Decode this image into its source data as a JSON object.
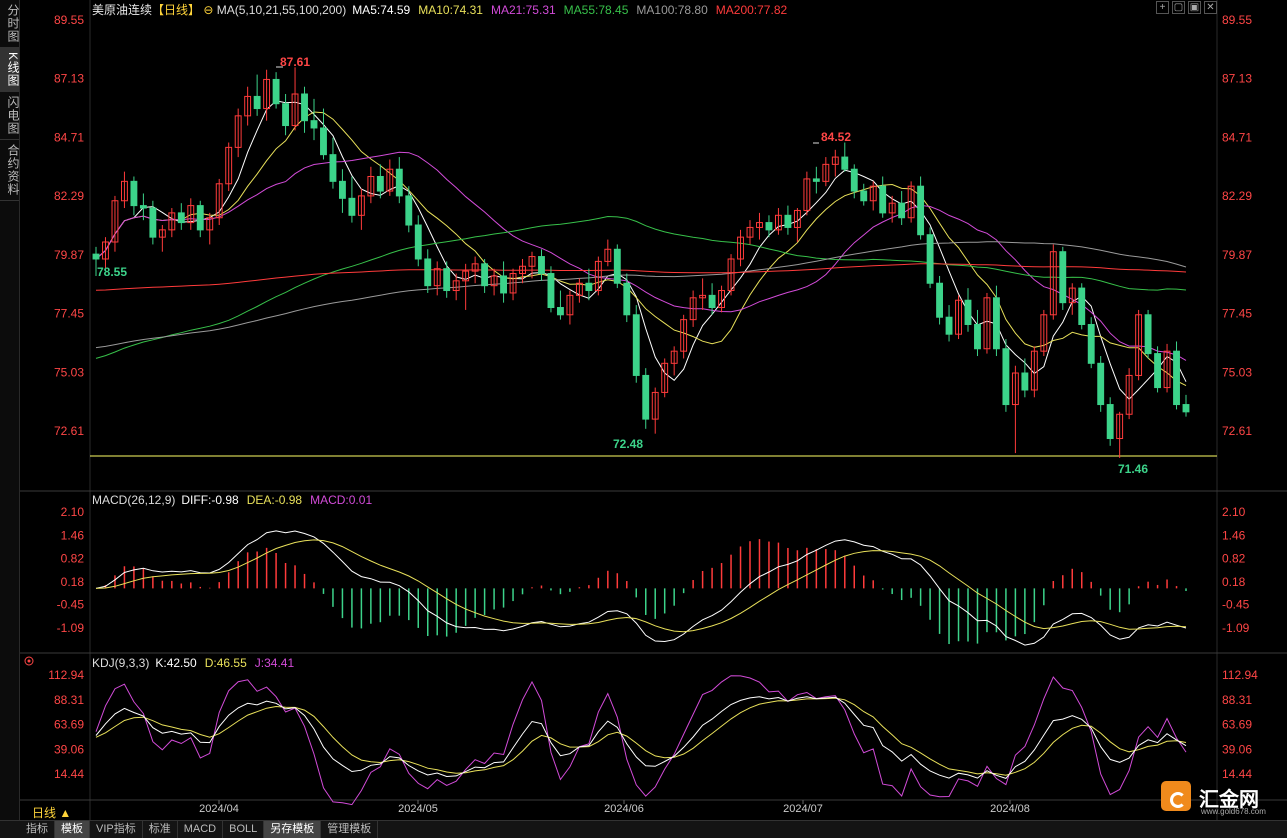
{
  "sidebar": {
    "tabs": [
      {
        "label": "分时图",
        "active": false
      },
      {
        "label": "K线图",
        "active": true
      },
      {
        "label": "闪电图",
        "active": false
      },
      {
        "label": "合约资料",
        "active": false
      }
    ]
  },
  "header": {
    "instrument": "美原油连续",
    "period_tag": "【日线】",
    "ma_label": "MA(5,10,21,55,100,200)",
    "ma5": "MA5:74.59",
    "ma10": "MA10:74.31",
    "ma21": "MA21:75.31",
    "ma55": "MA55:78.45",
    "ma100": "MA100:78.80",
    "ma200": "MA200:77.82"
  },
  "window_buttons": [
    "+",
    "▢",
    "▣",
    "✕"
  ],
  "colors": {
    "up": "#ff3b3b",
    "down": "#3cd38a",
    "ma5": "#ffffff",
    "ma10": "#e8e05a",
    "ma21": "#d24bd8",
    "ma55": "#37c04a",
    "ma100": "#9a9a9a",
    "ma200": "#ff3b3b",
    "axis_text": "#ff4646",
    "support_line": "#ffff66"
  },
  "price_axis": [
    "89.55",
    "87.13",
    "84.71",
    "82.29",
    "79.87",
    "77.45",
    "75.03",
    "72.61"
  ],
  "annotations": {
    "high_1": "87.61",
    "high_2": "84.52",
    "low_1": "72.48",
    "low_2": "71.46",
    "start": "78.55"
  },
  "macd": {
    "title": "MACD(26,12,9)",
    "diff": "DIFF:-0.98",
    "dea": "DEA:-0.98",
    "macd": "MACD:0.01",
    "axis": [
      "2.10",
      "1.46",
      "0.82",
      "0.18",
      "-0.45",
      "-1.09"
    ]
  },
  "kdj": {
    "title": "KDJ(9,3,3)",
    "k": "K:42.50",
    "d": "D:46.55",
    "j": "J:34.41",
    "axis": [
      "112.94",
      "88.31",
      "63.69",
      "39.06",
      "14.44"
    ]
  },
  "x_axis": [
    "2024/04",
    "2024/05",
    "2024/06",
    "2024/07",
    "2024/08"
  ],
  "period_selector": "日线 ▲",
  "bottom_tabs": [
    {
      "label": "指标",
      "active": false
    },
    {
      "label": "模板",
      "active": true
    },
    {
      "label": "VIP指标",
      "active": false
    },
    {
      "label": "标准",
      "active": false
    },
    {
      "label": "MACD",
      "active": false
    },
    {
      "label": "BOLL",
      "active": false
    },
    {
      "label": "另存模板",
      "active": true
    },
    {
      "label": "管理模板",
      "active": false
    }
  ],
  "logo": {
    "name": "汇金网",
    "site": "www.gold678.com"
  },
  "chart_data": {
    "type": "candlestick",
    "price_range": [
      71.0,
      90.0
    ],
    "candles": [
      [
        79.9,
        80.2,
        79.0,
        79.7
      ],
      [
        79.7,
        80.6,
        79.2,
        80.4
      ],
      [
        80.4,
        82.3,
        80.0,
        82.1
      ],
      [
        82.1,
        83.3,
        81.8,
        82.9
      ],
      [
        82.9,
        83.1,
        81.5,
        81.9
      ],
      [
        81.9,
        82.4,
        81.3,
        81.8
      ],
      [
        81.8,
        82.1,
        80.3,
        80.6
      ],
      [
        80.6,
        81.1,
        80.0,
        80.9
      ],
      [
        80.9,
        81.8,
        80.6,
        81.6
      ],
      [
        81.6,
        82.0,
        80.9,
        81.2
      ],
      [
        81.2,
        82.2,
        80.9,
        81.9
      ],
      [
        81.9,
        82.1,
        80.6,
        80.9
      ],
      [
        80.9,
        81.6,
        80.3,
        81.4
      ],
      [
        81.4,
        83.0,
        81.1,
        82.8
      ],
      [
        82.8,
        84.5,
        82.5,
        84.3
      ],
      [
        84.3,
        85.9,
        83.9,
        85.6
      ],
      [
        85.6,
        86.8,
        85.2,
        86.4
      ],
      [
        86.4,
        87.3,
        85.6,
        85.9
      ],
      [
        85.9,
        87.5,
        85.4,
        87.1
      ],
      [
        87.1,
        87.4,
        85.9,
        86.1
      ],
      [
        86.1,
        86.5,
        84.8,
        85.2
      ],
      [
        85.2,
        87.6,
        85.0,
        86.5
      ],
      [
        86.5,
        86.8,
        84.9,
        85.4
      ],
      [
        85.4,
        86.3,
        84.6,
        85.1
      ],
      [
        85.1,
        85.9,
        83.8,
        84.0
      ],
      [
        84.0,
        84.7,
        82.6,
        82.9
      ],
      [
        82.9,
        83.4,
        81.6,
        82.2
      ],
      [
        82.2,
        83.1,
        81.2,
        81.5
      ],
      [
        81.5,
        82.6,
        80.9,
        82.3
      ],
      [
        82.3,
        83.5,
        82.0,
        83.1
      ],
      [
        83.1,
        83.6,
        82.2,
        82.5
      ],
      [
        82.5,
        83.8,
        82.3,
        83.4
      ],
      [
        83.4,
        83.9,
        82.0,
        82.3
      ],
      [
        82.3,
        82.7,
        80.8,
        81.1
      ],
      [
        81.1,
        81.5,
        79.4,
        79.7
      ],
      [
        79.7,
        80.1,
        78.3,
        78.6
      ],
      [
        78.6,
        79.6,
        78.2,
        79.3
      ],
      [
        79.3,
        79.6,
        78.1,
        78.4
      ],
      [
        78.4,
        79.1,
        78.0,
        78.8
      ],
      [
        78.8,
        79.5,
        77.6,
        79.2
      ],
      [
        79.2,
        79.8,
        78.7,
        79.5
      ],
      [
        79.5,
        79.7,
        78.3,
        78.6
      ],
      [
        78.6,
        79.3,
        78.2,
        79.0
      ],
      [
        79.0,
        79.6,
        77.9,
        78.3
      ],
      [
        78.3,
        79.3,
        78.0,
        79.1
      ],
      [
        79.1,
        79.7,
        78.7,
        79.4
      ],
      [
        79.4,
        80.0,
        78.9,
        79.8
      ],
      [
        79.8,
        80.1,
        78.8,
        79.1
      ],
      [
        79.1,
        79.4,
        77.5,
        77.7
      ],
      [
        77.7,
        78.4,
        77.2,
        77.4
      ],
      [
        77.4,
        78.4,
        77.0,
        78.2
      ],
      [
        78.2,
        78.9,
        77.9,
        78.7
      ],
      [
        78.7,
        79.3,
        78.0,
        78.4
      ],
      [
        78.4,
        79.8,
        78.2,
        79.6
      ],
      [
        79.6,
        80.5,
        79.4,
        80.1
      ],
      [
        80.1,
        80.3,
        78.5,
        78.7
      ],
      [
        78.7,
        79.1,
        77.1,
        77.4
      ],
      [
        77.4,
        77.8,
        74.6,
        74.9
      ],
      [
        74.9,
        75.2,
        72.7,
        73.1
      ],
      [
        73.1,
        74.4,
        72.5,
        74.2
      ],
      [
        74.2,
        75.6,
        74.0,
        75.4
      ],
      [
        75.4,
        76.1,
        74.9,
        75.9
      ],
      [
        75.9,
        77.4,
        75.6,
        77.2
      ],
      [
        77.2,
        78.4,
        76.9,
        78.1
      ],
      [
        78.1,
        78.9,
        77.6,
        78.2
      ],
      [
        78.2,
        78.7,
        77.4,
        77.7
      ],
      [
        77.7,
        78.6,
        77.5,
        78.4
      ],
      [
        78.4,
        79.9,
        78.2,
        79.7
      ],
      [
        79.7,
        80.9,
        79.4,
        80.6
      ],
      [
        80.6,
        81.3,
        80.3,
        81.0
      ],
      [
        81.0,
        81.6,
        80.5,
        81.2
      ],
      [
        81.2,
        81.5,
        80.6,
        80.9
      ],
      [
        80.9,
        81.8,
        80.7,
        81.5
      ],
      [
        81.5,
        81.9,
        80.7,
        81.0
      ],
      [
        81.0,
        81.8,
        80.4,
        81.7
      ],
      [
        81.7,
        83.3,
        81.5,
        83.0
      ],
      [
        83.0,
        83.5,
        82.4,
        82.9
      ],
      [
        82.9,
        83.9,
        82.7,
        83.6
      ],
      [
        83.6,
        84.2,
        83.1,
        83.9
      ],
      [
        83.9,
        84.5,
        83.3,
        83.4
      ],
      [
        83.4,
        83.6,
        82.2,
        82.5
      ],
      [
        82.5,
        82.8,
        81.9,
        82.1
      ],
      [
        82.1,
        82.9,
        81.7,
        82.7
      ],
      [
        82.7,
        83.1,
        81.4,
        81.6
      ],
      [
        81.6,
        82.3,
        81.2,
        82.0
      ],
      [
        82.0,
        82.5,
        81.1,
        81.4
      ],
      [
        81.4,
        82.9,
        81.2,
        82.7
      ],
      [
        82.7,
        83.1,
        80.5,
        80.7
      ],
      [
        80.7,
        81.0,
        78.5,
        78.7
      ],
      [
        78.7,
        79.0,
        77.0,
        77.3
      ],
      [
        77.3,
        77.8,
        76.3,
        76.6
      ],
      [
        76.6,
        78.2,
        76.4,
        78.0
      ],
      [
        78.0,
        78.5,
        76.7,
        77.0
      ],
      [
        77.0,
        77.6,
        75.7,
        76.0
      ],
      [
        76.0,
        78.3,
        75.8,
        78.1
      ],
      [
        78.1,
        78.6,
        75.7,
        76.0
      ],
      [
        76.0,
        76.4,
        73.4,
        73.7
      ],
      [
        73.7,
        75.3,
        71.7,
        75.0
      ],
      [
        75.0,
        75.6,
        74.0,
        74.3
      ],
      [
        74.3,
        76.1,
        74.0,
        75.9
      ],
      [
        75.9,
        77.6,
        75.7,
        77.4
      ],
      [
        77.4,
        80.3,
        77.2,
        80.0
      ],
      [
        80.0,
        80.2,
        77.6,
        77.9
      ],
      [
        77.9,
        78.7,
        77.4,
        78.5
      ],
      [
        78.5,
        78.7,
        76.8,
        77.0
      ],
      [
        77.0,
        77.3,
        75.2,
        75.4
      ],
      [
        75.4,
        75.7,
        73.4,
        73.7
      ],
      [
        73.7,
        74.0,
        72.0,
        72.3
      ],
      [
        72.3,
        73.4,
        71.5,
        73.3
      ],
      [
        73.3,
        75.2,
        73.1,
        74.9
      ],
      [
        74.9,
        77.6,
        74.7,
        77.4
      ],
      [
        77.4,
        77.6,
        75.6,
        75.8
      ],
      [
        75.8,
        76.1,
        74.2,
        74.4
      ],
      [
        74.4,
        76.2,
        74.2,
        75.9
      ],
      [
        75.9,
        76.3,
        73.5,
        73.7
      ],
      [
        73.7,
        74.1,
        73.2,
        73.4
      ]
    ]
  }
}
